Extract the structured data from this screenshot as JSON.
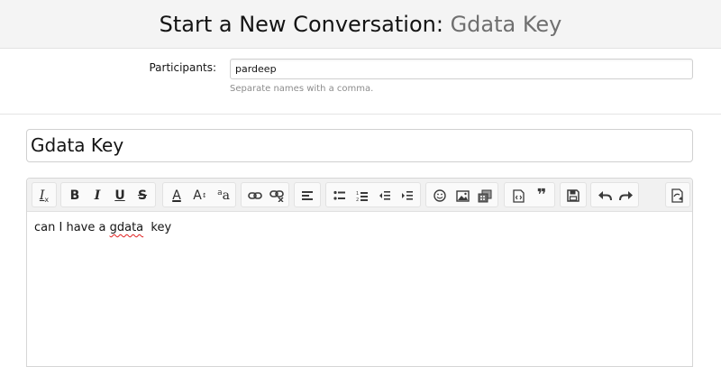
{
  "header": {
    "title_prefix": "Start a New Conversation: ",
    "title_subject": "Gdata Key"
  },
  "participants": {
    "label": "Participants:",
    "value": "pardeep",
    "hint": "Separate names with a comma."
  },
  "conversation": {
    "title_value": "Gdata Key"
  },
  "editor": {
    "toolbar_icons": [
      "remove-format-icon",
      "bold-icon",
      "italic-icon",
      "underline-icon",
      "strikethrough-icon",
      "font-color-icon",
      "font-size-icon",
      "font-family-icon",
      "link-icon",
      "unlink-icon",
      "align-icon",
      "bullet-list-icon",
      "numbered-list-icon",
      "outdent-icon",
      "indent-icon",
      "smilie-icon",
      "image-icon",
      "media-icon",
      "code-icon",
      "quote-icon",
      "save-draft-icon",
      "undo-icon",
      "redo-icon",
      "toggle-bbcode-icon"
    ],
    "content_before": "can I have a ",
    "content_misspelled": "gdata",
    "content_after": "  key",
    "glyphs": {
      "bold": "B",
      "italic": "I",
      "underline": "U",
      "strike": "S",
      "font_color": "A",
      "font_size": "A",
      "font_size_sup": "↕",
      "font_family": "a",
      "font_family_sub": "a",
      "remove_format": "I",
      "remove_format_sub": "x",
      "quote": "❞"
    }
  },
  "colors": {
    "title_subject": "#6f6f6f",
    "hint_text": "#8c8c8c",
    "spell_underline": "#e02020",
    "toolbar_bg": "#f1f1f1"
  }
}
